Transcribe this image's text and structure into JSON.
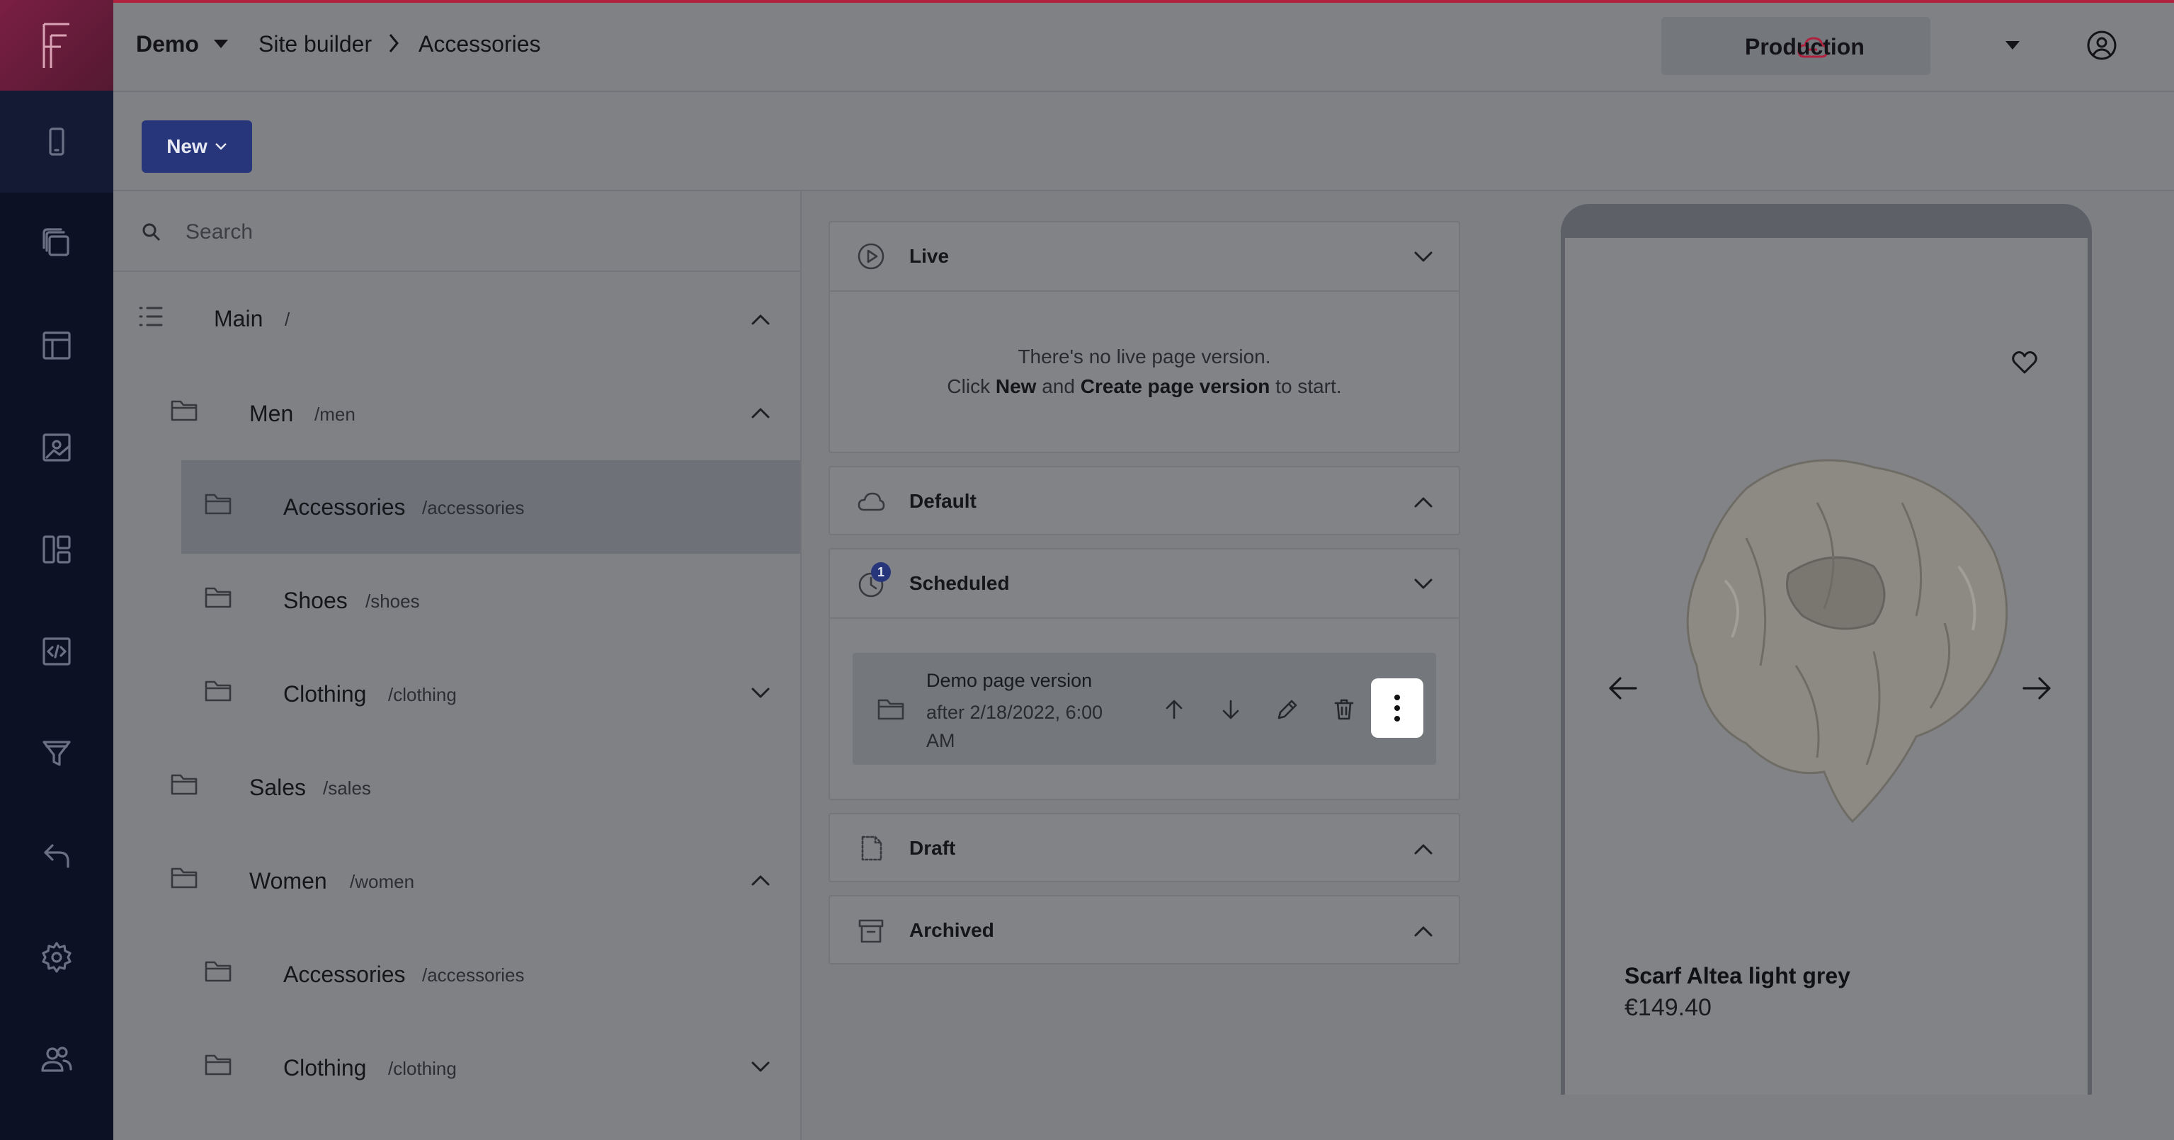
{
  "header": {
    "workspace": "Demo",
    "breadcrumb": [
      "Site builder",
      "Accessories"
    ],
    "environment": "Production"
  },
  "toolbar": {
    "new_label": "New"
  },
  "search": {
    "placeholder": "Search"
  },
  "tree": {
    "items": [
      {
        "label": "Main",
        "path": "/",
        "expanded": true
      },
      {
        "label": "Men",
        "path": "/men",
        "expanded": true
      },
      {
        "label": "Accessories",
        "path": "/accessories",
        "selected": true
      },
      {
        "label": "Shoes",
        "path": "/shoes"
      },
      {
        "label": "Clothing",
        "path": "/clothing",
        "expanded": false
      },
      {
        "label": "Sales",
        "path": "/sales"
      },
      {
        "label": "Women",
        "path": "/women",
        "expanded": true
      },
      {
        "label": "Accessories",
        "path": "/accessories"
      },
      {
        "label": "Clothing",
        "path": "/clothing",
        "expanded": false
      }
    ]
  },
  "sections": {
    "live": {
      "title": "Live",
      "empty_line1": "There's no live page version.",
      "empty_prefix": "Click ",
      "empty_new": "New",
      "empty_and": " and ",
      "empty_create": "Create page version",
      "empty_suffix": " to start."
    },
    "default": {
      "title": "Default"
    },
    "scheduled": {
      "title": "Scheduled",
      "badge": "1",
      "version": {
        "title": "Demo page version",
        "subtitle": "after 2/18/2022, 6:00 AM"
      }
    },
    "draft": {
      "title": "Draft"
    },
    "archived": {
      "title": "Archived"
    }
  },
  "preview": {
    "product_name": "Scarf Altea light grey",
    "product_price": "€149.40"
  },
  "colors": {
    "rail": "#0c1124",
    "accent": "#27367a",
    "logo": "#7a1f44",
    "env_cloud": "#b0213e"
  }
}
